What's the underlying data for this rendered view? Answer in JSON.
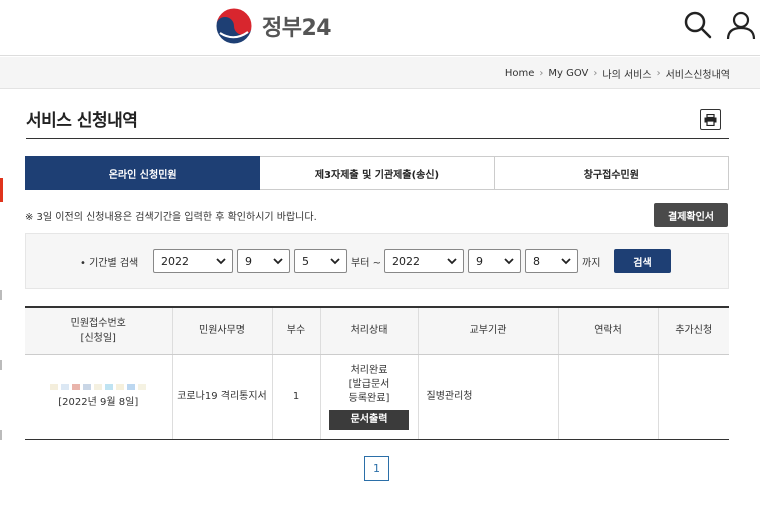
{
  "header": {
    "logo_text": "정부24",
    "icons": {
      "search": "search-icon",
      "user": "user-icon"
    },
    "brand_colors": {
      "red": "#d8262e",
      "blue": "#1e3f74"
    }
  },
  "breadcrumb": [
    "Home",
    "My GOV",
    "나의 서비스",
    "서비스신청내역"
  ],
  "page": {
    "title": "서비스 신청내역",
    "print_icon": "printer-icon"
  },
  "tabs": [
    {
      "label": "온라인 신청민원",
      "active": true
    },
    {
      "label": "제3자제출 및 기관제출(송신)",
      "active": false
    },
    {
      "label": "창구접수민원",
      "active": false
    }
  ],
  "notice": "※ 3일 이전의 신청내용은 검색기간을 입력한 후 확인하시기 바랍니다.",
  "receipt_button": "결제확인서",
  "filter": {
    "label": "• 기간별 검색",
    "from": {
      "year": "2022",
      "month": "9",
      "day": "5"
    },
    "from_suffix": "부터 ~",
    "to": {
      "year": "2022",
      "month": "9",
      "day": "8"
    },
    "to_suffix": "까지",
    "search_label": "검색"
  },
  "table": {
    "headers": [
      {
        "line1": "민원접수번호",
        "line2": "[신청일]"
      },
      {
        "line1": "민원사무명",
        "line2": ""
      },
      {
        "line1": "부수",
        "line2": ""
      },
      {
        "line1": "처리상태",
        "line2": ""
      },
      {
        "line1": "교부기관",
        "line2": ""
      },
      {
        "line1": "연락처",
        "line2": ""
      },
      {
        "line1": "추가신청",
        "line2": ""
      }
    ],
    "rows": [
      {
        "date": "[2022년 9월 8일]",
        "service": "코로나19 격리통지서",
        "count": "1",
        "status_line1": "처리완료",
        "status_line2": "[발급문서",
        "status_line3": "등록완료]",
        "doc_button": "문서출력",
        "org": "질병관리청",
        "contact": "",
        "extra": ""
      }
    ]
  },
  "pagination": {
    "current": "1"
  }
}
